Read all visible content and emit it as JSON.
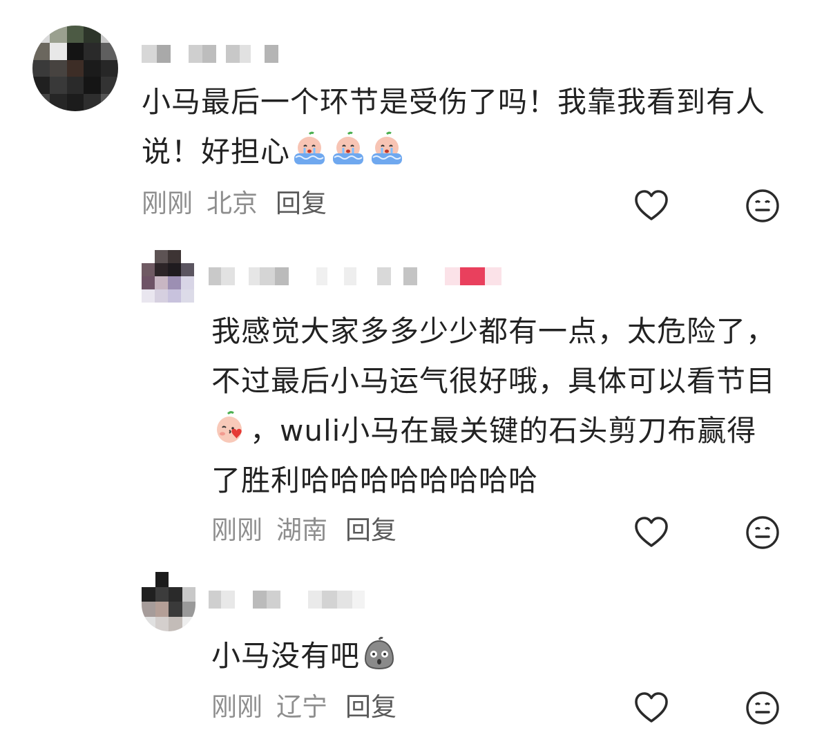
{
  "comments": [
    {
      "text": "小马最后一个环节是受伤了吗！我靠我看到有人说！好担心",
      "time": "刚刚",
      "location": "北京",
      "reply_label": "回复",
      "emojis": [
        "crying-peach-emoji",
        "crying-peach-emoji",
        "crying-peach-emoji"
      ]
    },
    {
      "text_before_emoji": "我感觉大家多多少少都有一点，太危险了，不过最后小马运气很好哦，具体可以看节目",
      "text_after_emoji": "，wuli小马在最关键的石头剪刀布赢得了胜利哈哈哈哈哈哈哈哈",
      "time": "刚刚",
      "location": "湖南",
      "reply_label": "回复",
      "emojis": [
        "kissing-peach-emoji"
      ]
    },
    {
      "text": "小马没有吧",
      "time": "刚刚",
      "location": "辽宁",
      "reply_label": "回复",
      "emojis": [
        "shocked-grey-emoji"
      ]
    }
  ],
  "colors": {
    "text": "#222222",
    "meta": "#8e8e8e",
    "reply": "#5a5a5a"
  },
  "icons": {
    "like": "heart-outline-icon",
    "dislike": "meh-face-icon"
  }
}
